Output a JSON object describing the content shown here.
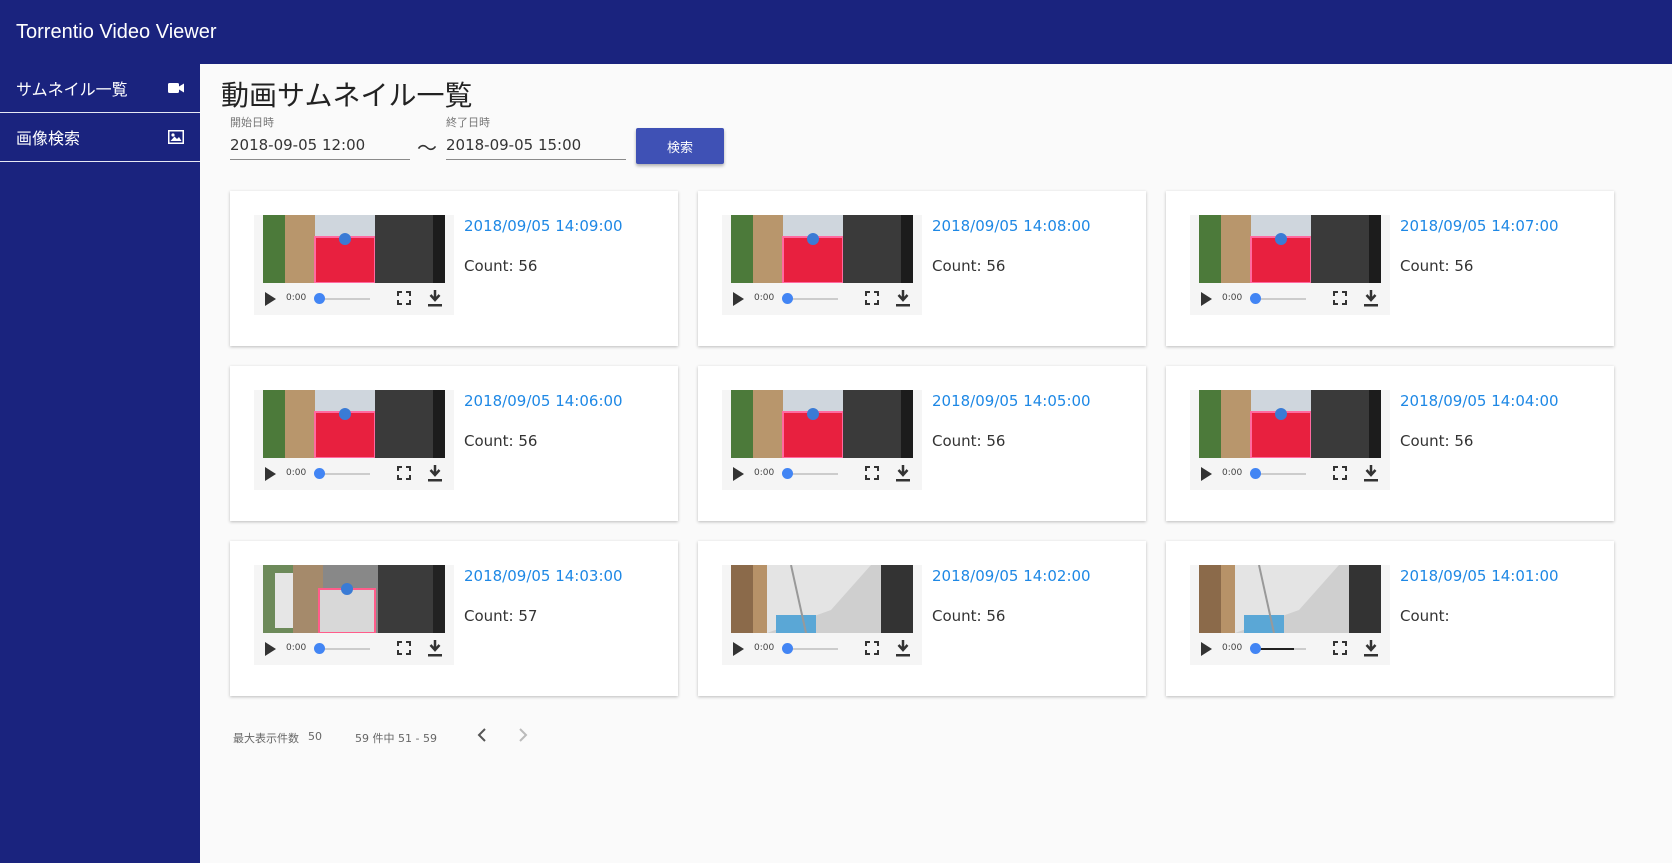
{
  "app": {
    "title": "Torrentio Video Viewer"
  },
  "sidebar": {
    "items": [
      {
        "label": "サムネイル一覧",
        "icon": "videocam-icon"
      },
      {
        "label": "画像検索",
        "icon": "image-icon"
      }
    ]
  },
  "main": {
    "title": "動画サムネイル一覧",
    "start": {
      "label": "開始日時",
      "value": "2018-09-05 12:00"
    },
    "separator": "～",
    "end": {
      "label": "終了日時",
      "value": "2018-09-05 15:00"
    },
    "search_label": "検索"
  },
  "cards": [
    {
      "date": "2018/09/05 14:09:00",
      "count": "Count: 56",
      "time": "0:00",
      "progress": 0,
      "scene": "red"
    },
    {
      "date": "2018/09/05 14:08:00",
      "count": "Count: 56",
      "time": "0:00",
      "progress": 0,
      "scene": "red"
    },
    {
      "date": "2018/09/05 14:07:00",
      "count": "Count: 56",
      "time": "0:00",
      "progress": 0,
      "scene": "red"
    },
    {
      "date": "2018/09/05 14:06:00",
      "count": "Count: 56",
      "time": "0:00",
      "progress": 0,
      "scene": "red"
    },
    {
      "date": "2018/09/05 14:05:00",
      "count": "Count: 56",
      "time": "0:00",
      "progress": 0,
      "scene": "red"
    },
    {
      "date": "2018/09/05 14:04:00",
      "count": "Count: 56",
      "time": "0:00",
      "progress": 0,
      "scene": "red"
    },
    {
      "date": "2018/09/05 14:03:00",
      "count": "Count: 57",
      "time": "0:00",
      "progress": 0,
      "scene": "person"
    },
    {
      "date": "2018/09/05 14:02:00",
      "count": "Count: 56",
      "time": "0:00",
      "progress": 0,
      "scene": "ceiling"
    },
    {
      "date": "2018/09/05 14:01:00",
      "count": "Count:",
      "time": "0:00",
      "progress": 0.75,
      "scene": "ceiling"
    }
  ],
  "paginator": {
    "page_size_label": "最大表示件数",
    "page_size": "50",
    "range_label": "59 件中 51 - 59"
  },
  "colors": {
    "primary": "#1a237e",
    "button": "#3f51b5",
    "link": "#1e88e5",
    "slider": "#4285f4"
  }
}
